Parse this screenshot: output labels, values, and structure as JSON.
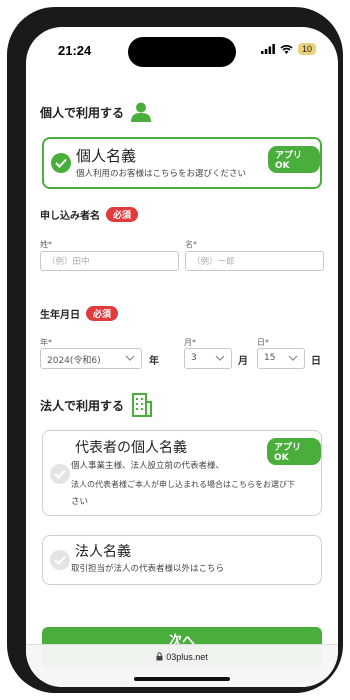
{
  "status_bar": {
    "time": "21:24",
    "battery": "10"
  },
  "personal": {
    "section_title": "個人で利用する",
    "card": {
      "title": "個人名義",
      "badge": "アプリOK",
      "desc": "個人利用のお客様はこちらをお選びください"
    }
  },
  "applicant": {
    "label": "申し込み者名",
    "required": "必須",
    "last_name": {
      "label": "姓*",
      "placeholder": "（例）田中"
    },
    "first_name": {
      "label": "名*",
      "placeholder": "（例）一郎"
    }
  },
  "birthdate": {
    "label": "生年月日",
    "required": "必須",
    "year": {
      "label": "年*",
      "value": "2024(令和6)",
      "unit": "年"
    },
    "month": {
      "label": "月*",
      "value": "3",
      "unit": "月"
    },
    "day": {
      "label": "日*",
      "value": "15",
      "unit": "日"
    }
  },
  "corporate": {
    "section_title": "法人で利用する",
    "rep_card": {
      "title": "代表者の個人名義",
      "badge": "アプリOK",
      "desc_1": "個人事業主様、法人設立前の代表者様、",
      "desc_2": "法人の代表者様ご本人が申し込まれる場合はこちらをお選び下",
      "desc_3": "さい"
    },
    "corp_card": {
      "title": "法人名義",
      "desc": "取引担当が法人の代表者様以外はこちら"
    }
  },
  "next_button": "次へ",
  "browser": {
    "url": "03plus.net"
  },
  "colors": {
    "accent": "#4aae3c",
    "required": "#e23b3b"
  }
}
